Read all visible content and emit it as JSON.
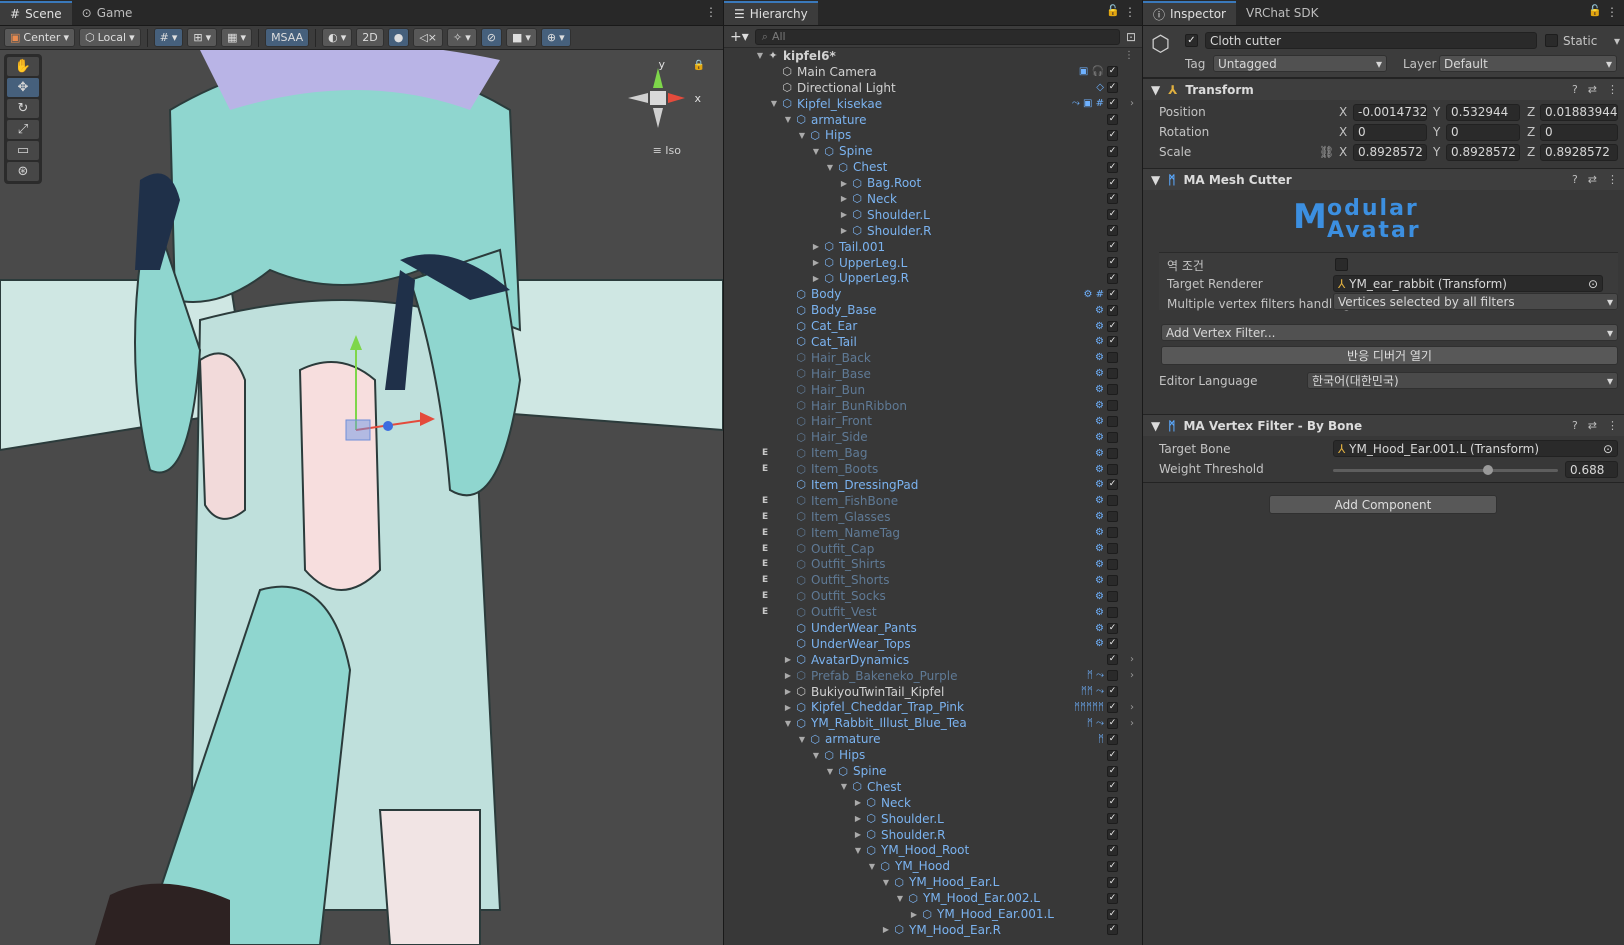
{
  "scene": {
    "tabs": [
      {
        "label": "Scene",
        "icon": "grid-icon"
      },
      {
        "label": "Game",
        "icon": "gamepad-icon"
      }
    ],
    "toolbar": {
      "pivot": "Center",
      "space": "Local",
      "msaa": "MSAA",
      "two_d": "2D"
    },
    "gizmo": {
      "y": "y",
      "x": "x",
      "projection": "Iso"
    }
  },
  "hierarchy": {
    "tab": "Hierarchy",
    "search_placeholder": "All",
    "root": "kipfel6*",
    "rows": [
      {
        "name": "Main Camera",
        "indent": 1,
        "arrow": "",
        "style": "plain",
        "badges": "▣ 🎧",
        "check": true,
        "editor": ""
      },
      {
        "name": "Directional Light",
        "indent": 1,
        "arrow": "",
        "style": "plain",
        "badges": "◇",
        "check": true,
        "editor": ""
      },
      {
        "name": "Kipfel_kisekae",
        "indent": 1,
        "arrow": "▼",
        "style": "prefab",
        "badges": "⤳ ▣ #",
        "check": true,
        "editor": "",
        "selected": false,
        "more": "›"
      },
      {
        "name": "armature",
        "indent": 2,
        "arrow": "▼",
        "style": "prefab",
        "badges": "",
        "check": true,
        "editor": ""
      },
      {
        "name": "Hips",
        "indent": 3,
        "arrow": "▼",
        "style": "prefab",
        "badges": "",
        "check": true,
        "editor": ""
      },
      {
        "name": "Spine",
        "indent": 4,
        "arrow": "▼",
        "style": "prefab",
        "badges": "",
        "check": true,
        "editor": ""
      },
      {
        "name": "Chest",
        "indent": 5,
        "arrow": "▼",
        "style": "prefab",
        "badges": "",
        "check": true,
        "editor": ""
      },
      {
        "name": "Bag.Root",
        "indent": 6,
        "arrow": "▶",
        "style": "prefab",
        "badges": "",
        "check": true,
        "editor": ""
      },
      {
        "name": "Neck",
        "indent": 6,
        "arrow": "▶",
        "style": "prefab",
        "badges": "",
        "check": true,
        "editor": ""
      },
      {
        "name": "Shoulder.L",
        "indent": 6,
        "arrow": "▶",
        "style": "prefab",
        "badges": "",
        "check": true,
        "editor": ""
      },
      {
        "name": "Shoulder.R",
        "indent": 6,
        "arrow": "▶",
        "style": "prefab",
        "badges": "",
        "check": true,
        "editor": ""
      },
      {
        "name": "Tail.001",
        "indent": 4,
        "arrow": "▶",
        "style": "prefab",
        "badges": "",
        "check": true,
        "editor": ""
      },
      {
        "name": "UpperLeg.L",
        "indent": 4,
        "arrow": "▶",
        "style": "prefab",
        "badges": "",
        "check": true,
        "editor": ""
      },
      {
        "name": "UpperLeg.R",
        "indent": 4,
        "arrow": "▶",
        "style": "prefab",
        "badges": "",
        "check": true,
        "editor": ""
      },
      {
        "name": "Body",
        "indent": 2,
        "arrow": "",
        "style": "prefab",
        "badges": "⚙ #",
        "check": true,
        "editor": ""
      },
      {
        "name": "Body_Base",
        "indent": 2,
        "arrow": "",
        "style": "prefab",
        "badges": "⚙",
        "check": true,
        "editor": ""
      },
      {
        "name": "Cat_Ear",
        "indent": 2,
        "arrow": "",
        "style": "prefab",
        "badges": "⚙",
        "check": true,
        "editor": ""
      },
      {
        "name": "Cat_Tail",
        "indent": 2,
        "arrow": "",
        "style": "prefab",
        "badges": "⚙",
        "check": true,
        "editor": ""
      },
      {
        "name": "Hair_Back",
        "indent": 2,
        "arrow": "",
        "style": "inactive",
        "badges": "⚙",
        "check": false,
        "editor": ""
      },
      {
        "name": "Hair_Base",
        "indent": 2,
        "arrow": "",
        "style": "inactive",
        "badges": "⚙",
        "check": false,
        "editor": ""
      },
      {
        "name": "Hair_Bun",
        "indent": 2,
        "arrow": "",
        "style": "inactive",
        "badges": "⚙",
        "check": false,
        "editor": ""
      },
      {
        "name": "Hair_BunRibbon",
        "indent": 2,
        "arrow": "",
        "style": "inactive",
        "badges": "⚙",
        "check": false,
        "editor": ""
      },
      {
        "name": "Hair_Front",
        "indent": 2,
        "arrow": "",
        "style": "inactive",
        "badges": "⚙",
        "check": false,
        "editor": ""
      },
      {
        "name": "Hair_Side",
        "indent": 2,
        "arrow": "",
        "style": "inactive",
        "badges": "⚙",
        "check": false,
        "editor": ""
      },
      {
        "name": "Item_Bag",
        "indent": 2,
        "arrow": "",
        "style": "inactive",
        "badges": "⚙",
        "check": false,
        "editor": "E"
      },
      {
        "name": "Item_Boots",
        "indent": 2,
        "arrow": "",
        "style": "inactive",
        "badges": "⚙",
        "check": false,
        "editor": "E"
      },
      {
        "name": "Item_DressingPad",
        "indent": 2,
        "arrow": "",
        "style": "prefab",
        "badges": "⚙",
        "check": true,
        "editor": ""
      },
      {
        "name": "Item_FishBone",
        "indent": 2,
        "arrow": "",
        "style": "inactive",
        "badges": "⚙",
        "check": false,
        "editor": "E"
      },
      {
        "name": "Item_Glasses",
        "indent": 2,
        "arrow": "",
        "style": "inactive",
        "badges": "⚙",
        "check": false,
        "editor": "E"
      },
      {
        "name": "Item_NameTag",
        "indent": 2,
        "arrow": "",
        "style": "inactive",
        "badges": "⚙",
        "check": false,
        "editor": "E"
      },
      {
        "name": "Outfit_Cap",
        "indent": 2,
        "arrow": "",
        "style": "inactive",
        "badges": "⚙",
        "check": false,
        "editor": "E"
      },
      {
        "name": "Outfit_Shirts",
        "indent": 2,
        "arrow": "",
        "style": "inactive",
        "badges": "⚙",
        "check": false,
        "editor": "E"
      },
      {
        "name": "Outfit_Shorts",
        "indent": 2,
        "arrow": "",
        "style": "inactive",
        "badges": "⚙",
        "check": false,
        "editor": "E"
      },
      {
        "name": "Outfit_Socks",
        "indent": 2,
        "arrow": "",
        "style": "inactive",
        "badges": "⚙",
        "check": false,
        "editor": "E"
      },
      {
        "name": "Outfit_Vest",
        "indent": 2,
        "arrow": "",
        "style": "inactive",
        "badges": "⚙",
        "check": false,
        "editor": "E"
      },
      {
        "name": "UnderWear_Pants",
        "indent": 2,
        "arrow": "",
        "style": "prefab",
        "badges": "⚙",
        "check": true,
        "editor": ""
      },
      {
        "name": "UnderWear_Tops",
        "indent": 2,
        "arrow": "",
        "style": "prefab",
        "badges": "⚙",
        "check": true,
        "editor": ""
      },
      {
        "name": "AvatarDynamics",
        "indent": 2,
        "arrow": "▶",
        "style": "prefab",
        "badges": "",
        "check": true,
        "editor": "",
        "more": "›"
      },
      {
        "name": "Prefab_Bakeneko_Purple",
        "indent": 2,
        "arrow": "▶",
        "style": "inactive",
        "badges": "ᛗ ⤳",
        "check": false,
        "editor": "",
        "more": "›"
      },
      {
        "name": "BukiyouTwinTail_Kipfel",
        "indent": 2,
        "arrow": "▶",
        "style": "plain",
        "badges": "ᛗᛗ ⤳",
        "check": true,
        "editor": ""
      },
      {
        "name": "Kipfel_Cheddar_Trap_Pink",
        "indent": 2,
        "arrow": "▶",
        "style": "prefab",
        "badges": "ᛗᛗᛗᛗᛗ",
        "check": true,
        "editor": "",
        "more": "›"
      },
      {
        "name": "YM_Rabbit_Illust_Blue_Tea",
        "indent": 2,
        "arrow": "▼",
        "style": "prefab",
        "badges": "ᛗ ⤳",
        "check": true,
        "editor": "",
        "more": "›"
      },
      {
        "name": "armature",
        "indent": 3,
        "arrow": "▼",
        "style": "prefab",
        "badges": "ᛗ",
        "check": true,
        "editor": ""
      },
      {
        "name": "Hips",
        "indent": 4,
        "arrow": "▼",
        "style": "prefab",
        "badges": "",
        "check": true,
        "editor": ""
      },
      {
        "name": "Spine",
        "indent": 5,
        "arrow": "▼",
        "style": "prefab",
        "badges": "",
        "check": true,
        "editor": ""
      },
      {
        "name": "Chest",
        "indent": 6,
        "arrow": "▼",
        "style": "prefab",
        "badges": "",
        "check": true,
        "editor": ""
      },
      {
        "name": "Neck",
        "indent": 7,
        "arrow": "▶",
        "style": "prefab",
        "badges": "",
        "check": true,
        "editor": ""
      },
      {
        "name": "Shoulder.L",
        "indent": 7,
        "arrow": "▶",
        "style": "prefab",
        "badges": "",
        "check": true,
        "editor": ""
      },
      {
        "name": "Shoulder.R",
        "indent": 7,
        "arrow": "▶",
        "style": "prefab",
        "badges": "",
        "check": true,
        "editor": ""
      },
      {
        "name": "YM_Hood_Root",
        "indent": 7,
        "arrow": "▼",
        "style": "prefab",
        "badges": "",
        "check": true,
        "editor": ""
      },
      {
        "name": "YM_Hood",
        "indent": 8,
        "arrow": "▼",
        "style": "prefab",
        "badges": "",
        "check": true,
        "editor": ""
      },
      {
        "name": "YM_Hood_Ear.L",
        "indent": 9,
        "arrow": "▼",
        "style": "prefab",
        "badges": "",
        "check": true,
        "editor": ""
      },
      {
        "name": "YM_Hood_Ear.002.L",
        "indent": 10,
        "arrow": "▼",
        "style": "prefab",
        "badges": "",
        "check": true,
        "editor": ""
      },
      {
        "name": "YM_Hood_Ear.001.L",
        "indent": 11,
        "arrow": "▶",
        "style": "prefab",
        "badges": "",
        "check": true,
        "editor": ""
      },
      {
        "name": "YM_Hood_Ear.R",
        "indent": 9,
        "arrow": "▶",
        "style": "prefab",
        "badges": "",
        "check": true,
        "editor": ""
      }
    ]
  },
  "inspector": {
    "tabs": [
      "Inspector",
      "VRChat SDK"
    ],
    "object_name": "Cloth cutter",
    "static_label": "Static",
    "tag_label": "Tag",
    "tag_value": "Untagged",
    "layer_label": "Layer",
    "layer_value": "Default",
    "transform": {
      "title": "Transform",
      "position_label": "Position",
      "rotation_label": "Rotation",
      "scale_label": "Scale",
      "position": {
        "x": "-0.0014732",
        "y": "0.532944",
        "z": "0.01883944"
      },
      "rotation": {
        "x": "0",
        "y": "0",
        "z": "0"
      },
      "scale": {
        "x": "0.8928572",
        "y": "0.8928572",
        "z": "0.8928572"
      }
    },
    "mesh_cutter": {
      "title": "MA Mesh Cutter",
      "logo_line1": "odular",
      "logo_line2": "Avatar",
      "inverse_label": "역 조건",
      "target_renderer_label": "Target Renderer",
      "target_renderer_value": "YM_ear_rabbit (Transform)",
      "multi_label": "Multiple vertex filters handling",
      "multi_value": "Vertices selected by all filters",
      "add_filter": "Add Vertex Filter...",
      "debugger_button": "반응 디버거 열기",
      "language_label": "Editor Language",
      "language_value": "한국어(대한민국)"
    },
    "vertex_filter": {
      "title": "MA Vertex Filter - By Bone",
      "target_bone_label": "Target Bone",
      "target_bone_value": "YM_Hood_Ear.001.L (Transform)",
      "threshold_label": "Weight Threshold",
      "threshold_value": "0.688",
      "threshold_fraction": 0.688
    },
    "add_component": "Add Component"
  },
  "colors": {
    "selection": "#2c5d87",
    "prefab_text": "#7bb3f0",
    "accent": "#3a79bb"
  }
}
